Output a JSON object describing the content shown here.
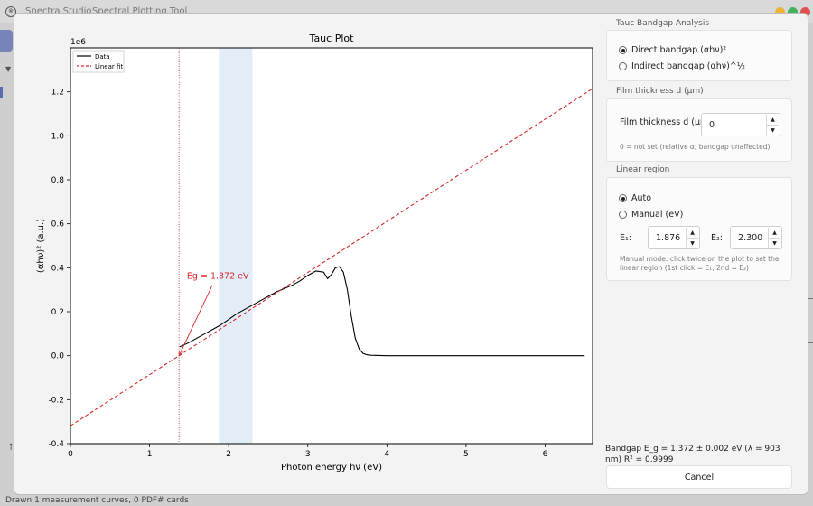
{
  "app": {
    "title": "Spectra Studio",
    "tool_title": "Spectral Plotting Tool",
    "status": "Drawn 1 measurement curves, 0 PDF# cards",
    "colors": {
      "accent": "#5b6bb0",
      "close": "#e05252",
      "minimize": "#e8b53a",
      "maximize": "#43b05c"
    }
  },
  "dialog": {
    "panel": {
      "method_group_title": "Tauc Bandgap Analysis",
      "method_options": [
        {
          "label": "Direct bandgap (αhν)²",
          "selected": true
        },
        {
          "label": "Indirect bandgap (αhν)^½",
          "selected": false
        }
      ],
      "thickness_group_title": "Film thickness d (µm)",
      "thickness_label": "Film thickness d (µm):",
      "thickness_value": "0",
      "thickness_hint": "0 = not set (relative α; bandgap unaffected)",
      "region_group_title": "Linear region",
      "region_options": [
        {
          "label": "Auto",
          "selected": true
        },
        {
          "label": "Manual (eV)",
          "selected": false
        }
      ],
      "e1_label": "E₁:",
      "e1_value": "1.876",
      "e2_label": "E₂:",
      "e2_value": "2.300",
      "region_hint": "Manual mode: click twice on the plot to set the linear region (1st click = E₁, 2nd = E₂)",
      "result_text": "Bandgap E_g = 1.372 ± 0.002 eV (λ = 903 nm)   R² = 0.9999",
      "cancel_label": "Cancel"
    }
  },
  "chart_data": {
    "type": "line",
    "title": "Tauc Plot",
    "xlabel": "Photon energy hν (eV)",
    "ylabel": "(αhν)² (a.u.)",
    "y_multiplier_label": "1e6",
    "xlim": [
      0,
      6.6
    ],
    "ylim": [
      -0.4,
      1.4
    ],
    "xticks": [
      0,
      1,
      2,
      3,
      4,
      5,
      6
    ],
    "xtick_labels": [
      "0",
      "1",
      "2",
      "3",
      "4",
      "5",
      "6"
    ],
    "yticks": [
      -0.4,
      -0.2,
      0,
      0.2,
      0.4,
      0.6,
      0.8,
      1.0,
      1.2
    ],
    "ytick_labels": [
      "-0.4",
      "-0.2",
      "0.0",
      "0.2",
      "0.4",
      "0.6",
      "0.8",
      "1.0",
      "1.2"
    ],
    "grid": false,
    "legend_position": "top-left",
    "series": [
      {
        "name": "Data",
        "color": "#000000",
        "style": "solid",
        "x": [
          1.38,
          1.5,
          1.6,
          1.7,
          1.8,
          1.9,
          2.0,
          2.1,
          2.2,
          2.3,
          2.4,
          2.5,
          2.6,
          2.7,
          2.8,
          2.9,
          3.0,
          3.1,
          3.2,
          3.25,
          3.3,
          3.35,
          3.4,
          3.45,
          3.5,
          3.55,
          3.6,
          3.65,
          3.7,
          3.75,
          3.8,
          3.9,
          4.0,
          4.5,
          5.0,
          5.5,
          6.0,
          6.5
        ],
        "y": [
          0.04,
          0.06,
          0.08,
          0.1,
          0.12,
          0.14,
          0.165,
          0.19,
          0.21,
          0.23,
          0.25,
          0.27,
          0.29,
          0.305,
          0.32,
          0.34,
          0.365,
          0.385,
          0.38,
          0.35,
          0.37,
          0.4,
          0.405,
          0.38,
          0.3,
          0.18,
          0.08,
          0.03,
          0.01,
          0.004,
          0.002,
          0.001,
          0,
          0,
          0,
          0,
          0,
          0
        ]
      },
      {
        "name": "Linear fit",
        "color": "#d62728",
        "style": "dashed",
        "x": [
          0,
          6.6
        ],
        "y": [
          -0.3188,
          1.2149
        ]
      }
    ],
    "bandgap_eV": 1.372,
    "fit_region": [
      1.876,
      2.3
    ],
    "annotation": {
      "text": "Eg = 1.372 eV",
      "arrow_to": [
        1.372,
        0
      ]
    }
  }
}
